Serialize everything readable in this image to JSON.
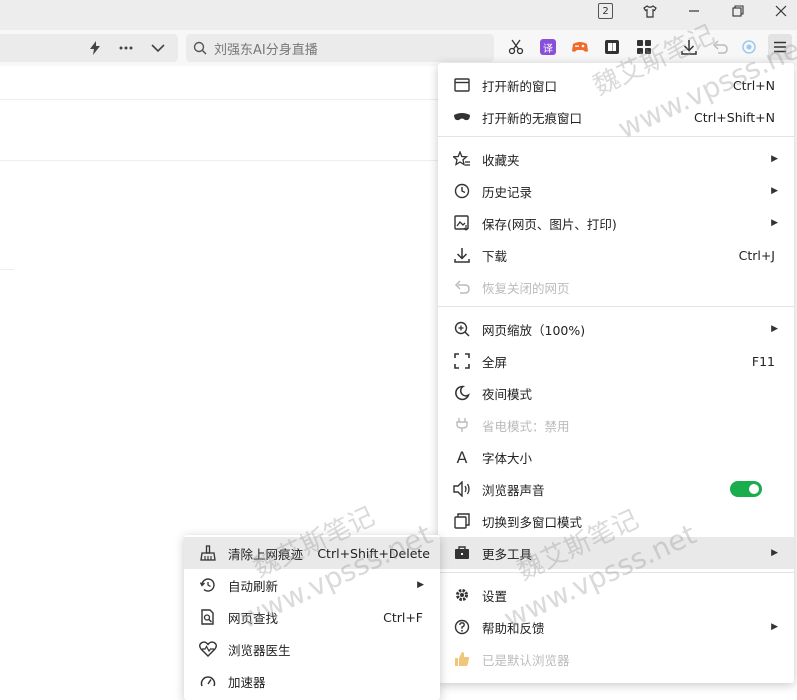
{
  "window": {
    "tab_count": "2"
  },
  "search": {
    "text": "刘强东AI分身直播"
  },
  "main_menu": {
    "items": [
      {
        "label": "打开新的窗口",
        "shortcut": "Ctrl+N"
      },
      {
        "label": "打开新的无痕窗口",
        "shortcut": "Ctrl+Shift+N"
      },
      {
        "label": "收藏夹"
      },
      {
        "label": "历史记录"
      },
      {
        "label": "保存(网页、图片、打印)"
      },
      {
        "label": "下载",
        "shortcut": "Ctrl+J"
      },
      {
        "label": "恢复关闭的网页"
      },
      {
        "label": "网页缩放（100%)"
      },
      {
        "label": "全屏",
        "shortcut": "F11"
      },
      {
        "label": "夜间模式"
      },
      {
        "label": "省电模式：禁用"
      },
      {
        "label": "字体大小"
      },
      {
        "label": "浏览器声音"
      },
      {
        "label": "切换到多窗口模式"
      },
      {
        "label": "更多工具"
      },
      {
        "label": "设置"
      },
      {
        "label": "帮助和反馈"
      },
      {
        "label": "已是默认浏览器"
      }
    ]
  },
  "sub_menu": {
    "items": [
      {
        "label": "清除上网痕迹",
        "shortcut": "Ctrl+Shift+Delete"
      },
      {
        "label": "自动刷新"
      },
      {
        "label": "网页查找",
        "shortcut": "Ctrl+F"
      },
      {
        "label": "浏览器医生"
      },
      {
        "label": "加速器"
      }
    ]
  },
  "watermark": {
    "line1": "魏艾斯笔记",
    "line2": "www.vpsss.net"
  },
  "colors": {
    "toggle_on": "#1aad4e",
    "highlight": "#e9e9e9"
  }
}
